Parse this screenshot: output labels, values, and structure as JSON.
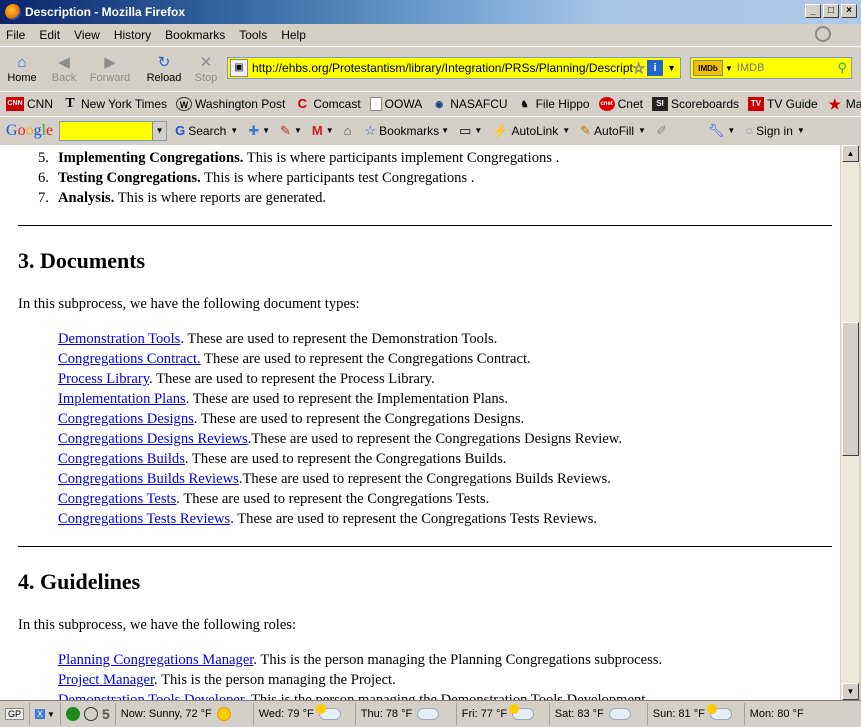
{
  "window": {
    "title": "Description - Mozilla Firefox"
  },
  "menu": [
    "File",
    "Edit",
    "View",
    "History",
    "Bookmarks",
    "Tools",
    "Help"
  ],
  "nav": {
    "home": "Home",
    "back": "Back",
    "forward": "Forward",
    "reload": "Reload",
    "stop": "Stop",
    "url": "http://ehbs.org/Protestantism/library/Integration/PRSs/Planning/Description",
    "search_placeholder": "IMDB",
    "search_engine": "IMDb"
  },
  "bookmarks": [
    {
      "label": "CNN",
      "icon": "cnn-icon",
      "badge": "CNN"
    },
    {
      "label": "New York Times",
      "icon": "nyt-icon",
      "badge": "T"
    },
    {
      "label": "Washington Post",
      "icon": "wapo-icon",
      "badge": "W"
    },
    {
      "label": "Comcast",
      "icon": "comcast-icon",
      "badge": "C"
    },
    {
      "label": "OOWA",
      "icon": "page-icon",
      "badge": ""
    },
    {
      "label": "NASAFCU",
      "icon": "nasafcu-icon",
      "badge": "N"
    },
    {
      "label": "File Hippo",
      "icon": "filehippo-icon",
      "badge": "F"
    },
    {
      "label": "Cnet",
      "icon": "cnet-icon",
      "badge": "c"
    },
    {
      "label": "Scoreboards",
      "icon": "si-icon",
      "badge": "SI"
    },
    {
      "label": "TV Guide",
      "icon": "tvguide-icon",
      "badge": "TV"
    },
    {
      "label": "MapQuest",
      "icon": "mapquest-icon",
      "badge": "★"
    }
  ],
  "google_toolbar": {
    "logo": "Google",
    "search": "Search",
    "bookmarks": "Bookmarks",
    "autolink": "AutoLink",
    "autofill": "AutoFill",
    "signin": "Sign in"
  },
  "content": {
    "list": [
      {
        "num": "5.",
        "bold": "Implementing Congregations.",
        "text": " This is where participants implement Congregations ."
      },
      {
        "num": "6.",
        "bold": "Testing Congregations.",
        "text": " This is where participants test Congregations ."
      },
      {
        "num": "7.",
        "bold": "Analysis.",
        "text": " This is where reports are generated."
      }
    ],
    "documents": {
      "heading": "3. Documents",
      "intro": "In this subprocess, we have the following document types:",
      "items": [
        {
          "link": "Demonstration Tools",
          "text": ". These are used to represent the Demonstration Tools."
        },
        {
          "link": "Congregations Contract.",
          "text": " These are used to represent the Congregations Contract."
        },
        {
          "link": "Process Library",
          "text": ". These are used to represent the Process Library."
        },
        {
          "link": "Implementation Plans",
          "text": ". These are used to represent the Implementation Plans."
        },
        {
          "link": "Congregations Designs",
          "text": ". These are used to represent the Congregations Designs."
        },
        {
          "link": "Congregations Designs Reviews",
          "text": ".These are used to represent the Congregations Designs Review."
        },
        {
          "link": "Congregations Builds",
          "text": ". These are used to represent the Congregations Builds."
        },
        {
          "link": "Congregations Builds Reviews",
          "text": ".These are used to represent the Congregations Builds Reviews."
        },
        {
          "link": "Congregations Tests",
          "text": ". These are used to represent the Congregations Tests."
        },
        {
          "link": "Congregations Tests Reviews",
          "text": ". These are used to represent the Congregations Tests Reviews."
        }
      ]
    },
    "guidelines": {
      "heading": "4. Guidelines",
      "intro": "In this subprocess, we have the following roles:",
      "items": [
        {
          "link": "Planning Congregations Manager",
          "text": ". This is the person managing the Planning Congregations subprocess."
        },
        {
          "link": "Project Manager",
          "text": ". This is the person managing the Project."
        },
        {
          "link": "Demonstration Tools Developer",
          "text": ". This is the person managing the Demonstration Tools Development."
        }
      ]
    }
  },
  "statusbar": {
    "gp": "GP",
    "count": "5",
    "weather": [
      {
        "label": "Now: Sunny, 72 °F",
        "icon": "sun-icon"
      },
      {
        "label": "Wed: 79 °F",
        "icon": "partly-cloudy-icon"
      },
      {
        "label": "Thu: 78 °F",
        "icon": "cloudy-icon"
      },
      {
        "label": "Fri: 77 °F",
        "icon": "partly-cloudy-icon"
      },
      {
        "label": "Sat: 83 °F",
        "icon": "cloudy-icon"
      },
      {
        "label": "Sun: 81 °F",
        "icon": "partly-cloudy-icon"
      },
      {
        "label": "Mon: 80 °F",
        "icon": ""
      }
    ]
  }
}
